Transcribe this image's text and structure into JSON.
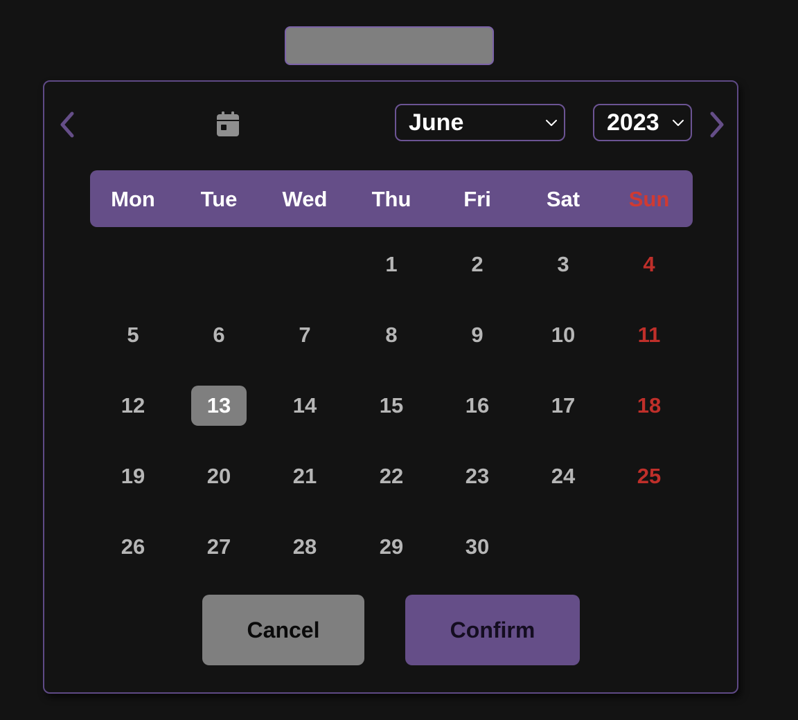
{
  "date_input": {
    "value": ""
  },
  "header": {
    "prev_icon": "chevron-left-icon",
    "next_icon": "chevron-right-icon",
    "today_icon": "calendar-icon",
    "month": "June",
    "year": "2023"
  },
  "weekdays": [
    "Mon",
    "Tue",
    "Wed",
    "Thu",
    "Fri",
    "Sat",
    "Sun"
  ],
  "days": {
    "first_weekday_index": 3,
    "count": 30,
    "selected": 13,
    "labels": [
      "1",
      "2",
      "3",
      "4",
      "5",
      "6",
      "7",
      "8",
      "9",
      "10",
      "11",
      "12",
      "13",
      "14",
      "15",
      "16",
      "17",
      "18",
      "19",
      "20",
      "21",
      "22",
      "23",
      "24",
      "25",
      "26",
      "27",
      "28",
      "29",
      "30"
    ]
  },
  "buttons": {
    "cancel": "Cancel",
    "confirm": "Confirm"
  },
  "colors": {
    "background": "#131313",
    "accent": "#654e88",
    "sunday": "#bf2f2a",
    "selected_day": "#7f7f7f",
    "day_text": "#b6b6b6"
  }
}
